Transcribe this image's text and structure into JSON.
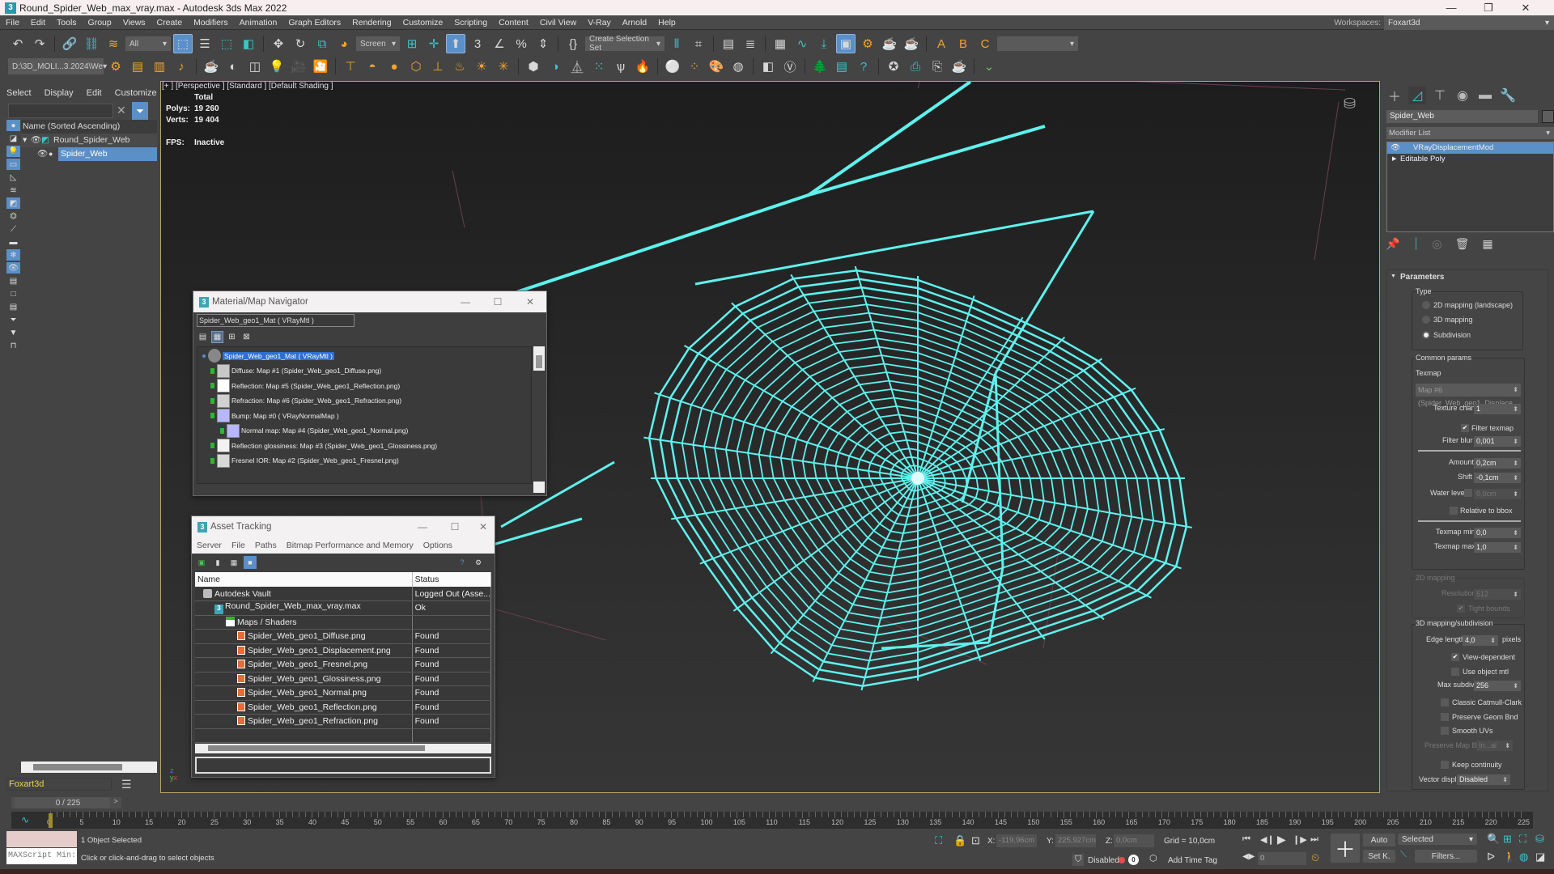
{
  "window": {
    "title": "Round_Spider_Web_max_vray.max - Autodesk 3ds Max 2022",
    "minimize": "—",
    "restore": "❐",
    "close": "✕"
  },
  "menu": [
    "File",
    "Edit",
    "Tools",
    "Group",
    "Views",
    "Create",
    "Modifiers",
    "Animation",
    "Graph Editors",
    "Rendering",
    "Customize",
    "Scripting",
    "Content",
    "Civil View",
    "V-Ray",
    "Arnold",
    "Help"
  ],
  "workspaces": {
    "label": "Workspaces:",
    "value": "Foxart3d"
  },
  "toolbar1": {
    "selection_filter": "All",
    "ref_coord": "Screen",
    "selection_set_placeholder": "Create Selection Set"
  },
  "toolbar2": {
    "project_path": "D:\\3D_MOLI...3.2024\\We"
  },
  "scene_explorer": {
    "tabs": [
      "Select",
      "Display",
      "Edit",
      "Customize"
    ],
    "header": "Name (Sorted Ascending)",
    "items": [
      {
        "name": "Round_Spider_Web",
        "level": 0,
        "selected": false
      },
      {
        "name": "Spider_Web",
        "level": 1,
        "selected": true
      }
    ],
    "layer": "Foxart3d"
  },
  "viewport": {
    "label": "[+ ] [Perspective ]  [Standard ]  [Default Shading ]",
    "stats_header": "Total",
    "polys_label": "Polys:",
    "polys": "19 260",
    "verts_label": "Verts:",
    "verts": "19 404",
    "fps_label": "FPS:",
    "fps": "Inactive",
    "wire_color": "#5ef2ee"
  },
  "material_navigator": {
    "title": "Material/Map Navigator",
    "current": "Spider_Web_geo1_Mat  ( VRayMtl )",
    "tree": [
      {
        "label": "Spider_Web_geo1_Mat  ( VRayMtl )",
        "level": 0,
        "swatch": "#888888",
        "selected": true
      },
      {
        "label": "Diffuse: Map #1 (Spider_Web_geo1_Diffuse.png)",
        "level": 1,
        "swatch": "#c8c8c8"
      },
      {
        "label": "Reflection: Map #5 (Spider_Web_geo1_Reflection.png)",
        "level": 1,
        "swatch": "#ffffff"
      },
      {
        "label": "Refraction: Map #6 (Spider_Web_geo1_Refraction.png)",
        "level": 1,
        "swatch": "#d0d0d0"
      },
      {
        "label": "Bump: Map #0  ( VRayNormalMap )",
        "level": 1,
        "swatch": "#b7b7ff"
      },
      {
        "label": "Normal map: Map #4 (Spider_Web_geo1_Normal.png)",
        "level": 2,
        "swatch": "#b7b7ff"
      },
      {
        "label": "Reflection glossiness: Map #3 (Spider_Web_geo1_Glossiness.png)",
        "level": 1,
        "swatch": "#f2f2f2"
      },
      {
        "label": "Fresnel IOR: Map #2 (Spider_Web_geo1_Fresnel.png)",
        "level": 1,
        "swatch": "#d8d8d8"
      }
    ]
  },
  "asset_tracking": {
    "title": "Asset Tracking",
    "menu": [
      "Server",
      "File",
      "Paths",
      "Bitmap Performance and Memory",
      "Options"
    ],
    "columns": [
      "Name",
      "Status"
    ],
    "rows": [
      {
        "name": "Autodesk Vault",
        "status": "Logged Out (Asse...",
        "level": 0,
        "icon": "vault"
      },
      {
        "name": "Round_Spider_Web_max_vray.max",
        "status": "Ok",
        "level": 1,
        "icon": "max"
      },
      {
        "name": "Maps / Shaders",
        "status": "",
        "level": 2,
        "icon": "folder"
      },
      {
        "name": "Spider_Web_geo1_Diffuse.png",
        "status": "Found",
        "level": 3,
        "icon": "png"
      },
      {
        "name": "Spider_Web_geo1_Displacement.png",
        "status": "Found",
        "level": 3,
        "icon": "png"
      },
      {
        "name": "Spider_Web_geo1_Fresnel.png",
        "status": "Found",
        "level": 3,
        "icon": "png"
      },
      {
        "name": "Spider_Web_geo1_Glossiness.png",
        "status": "Found",
        "level": 3,
        "icon": "png"
      },
      {
        "name": "Spider_Web_geo1_Normal.png",
        "status": "Found",
        "level": 3,
        "icon": "png"
      },
      {
        "name": "Spider_Web_geo1_Reflection.png",
        "status": "Found",
        "level": 3,
        "icon": "png"
      },
      {
        "name": "Spider_Web_geo1_Refraction.png",
        "status": "Found",
        "level": 3,
        "icon": "png"
      }
    ]
  },
  "command_panel": {
    "object_name": "Spider_Web",
    "modifier_list": "Modifier List",
    "stack": [
      {
        "label": "VRayDisplacementMod",
        "selected": true
      },
      {
        "label": "Editable Poly",
        "selected": false
      }
    ],
    "rollout": "Parameters",
    "type_group": "Type",
    "type_options": [
      {
        "label": "2D mapping (landscape)",
        "checked": false
      },
      {
        "label": "3D mapping",
        "checked": false
      },
      {
        "label": "Subdivision",
        "checked": true
      }
    ],
    "common_group": "Common params",
    "texmap_label": "Texmap",
    "texmap_value": "Map #6 (Spider_Web_geo1_Displace",
    "texture_chan_label": "Texture chan",
    "texture_chan": "1",
    "filter_texmap_label": "Filter texmap",
    "filter_texmap": true,
    "filter_blur_label": "Filter blur",
    "filter_blur": "0,001",
    "amount_label": "Amount",
    "amount": "0,2cm",
    "shift_label": "Shift",
    "shift": "-0,1cm",
    "water_level_label": "Water level",
    "water_level": "0,0cm",
    "relative_bbox_label": "Relative to bbox",
    "texmap_min_label": "Texmap min",
    "texmap_min": "0,0",
    "texmap_max_label": "Texmap max",
    "texmap_max": "1,0",
    "map2d_group": "2D mapping",
    "resolution_label": "Resolution",
    "resolution": "512",
    "tight_bounds_label": "Tight bounds",
    "map3d_group": "3D mapping/subdivision",
    "edge_length_label": "Edge length",
    "edge_length": "4,0",
    "edge_unit": "pixels",
    "view_dependent_label": "View-dependent",
    "view_dependent": true,
    "use_object_mtl_label": "Use object mtl",
    "max_subdivs_label": "Max subdivs",
    "max_subdivs": "256",
    "classic_cc_label": "Classic Catmull-Clark",
    "preserve_geom_label": "Preserve Geom Bnd",
    "smooth_uvs_label": "Smooth UVs",
    "preserve_map_label": "Preserve Map Bnd",
    "preserve_map": "In...al",
    "keep_continuity_label": "Keep continuity",
    "vector_displ_label": "Vector displ",
    "vector_displ": "Disabled"
  },
  "timeline": {
    "frame": "0 / 225",
    "prev": "<",
    "next": ">",
    "ticks": [
      0,
      5,
      10,
      15,
      20,
      25,
      30,
      35,
      40,
      45,
      50,
      55,
      60,
      65,
      70,
      75,
      80,
      85,
      90,
      95,
      100,
      105,
      110,
      115,
      120,
      125,
      130,
      135,
      140,
      145,
      150,
      155,
      160,
      165,
      170,
      175,
      180,
      185,
      190,
      195,
      200,
      205,
      210,
      215,
      220,
      225
    ],
    "current": 0,
    "total": 225
  },
  "status": {
    "maxscript": "MAXScript Min:",
    "selection": "1 Object Selected",
    "prompt": "Click or click-and-drag to select objects",
    "x_label": "X:",
    "x": "-119,96cm",
    "y_label": "Y:",
    "y": "225,927cm",
    "z_label": "Z:",
    "z": "0,0cm",
    "grid": "Grid = 10,0cm",
    "disabled_label": "Disabled:",
    "time_tag": "Add Time Tag",
    "auto": "Auto",
    "set_key": "Set K.",
    "key_filter": "Selected",
    "filters": "Filters...",
    "frame_field": "0"
  }
}
